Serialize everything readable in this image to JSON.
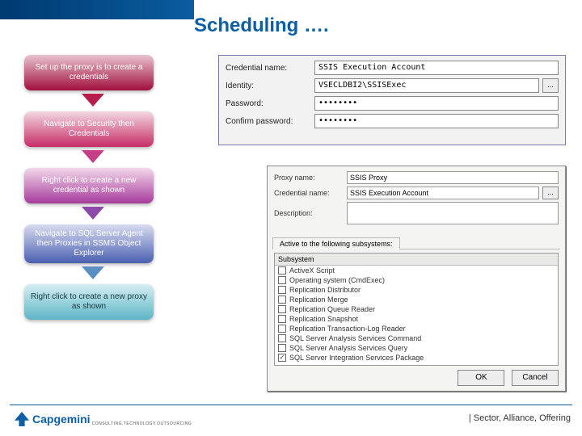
{
  "title": "Scheduling ….",
  "steps": [
    "Set up the proxy is to create a credentials",
    "Navigate to Security then Credentials",
    "Right click to create a new credential as shown",
    "Navigate to SQL Server Agent then Proxies in SSMS Object Explorer",
    "Right click to create a new proxy as shown"
  ],
  "credential": {
    "labels": {
      "name": "Credential name:",
      "identity": "Identity:",
      "password": "Password:",
      "confirm": "Confirm password:"
    },
    "values": {
      "name": "SSIS Execution Account",
      "identity": "VSECLDBI2\\SSISExec",
      "password": "••••••••",
      "confirm": "••••••••",
      "browse": "..."
    }
  },
  "proxy": {
    "labels": {
      "proxy_name": "Proxy name:",
      "cred_name": "Credential name:",
      "description": "Description:",
      "tab": "Active to the following subsystems:"
    },
    "values": {
      "proxy_name": "SSIS Proxy",
      "cred_name": "SSIS Execution Account",
      "browse": "..."
    },
    "list_header": "Subsystem",
    "subsystems": [
      {
        "label": "ActiveX Script",
        "checked": false
      },
      {
        "label": "Operating system (CmdExec)",
        "checked": false
      },
      {
        "label": "Replication Distributor",
        "checked": false
      },
      {
        "label": "Replication Merge",
        "checked": false
      },
      {
        "label": "Replication Queue Reader",
        "checked": false
      },
      {
        "label": "Replication Snapshot",
        "checked": false
      },
      {
        "label": "Replication Transaction-Log Reader",
        "checked": false
      },
      {
        "label": "SQL Server Analysis Services Command",
        "checked": false
      },
      {
        "label": "SQL Server Analysis Services Query",
        "checked": false
      },
      {
        "label": "SQL Server Integration Services Package",
        "checked": true
      }
    ],
    "buttons": {
      "ok": "OK",
      "cancel": "Cancel"
    }
  },
  "footer": "| Sector, Alliance, Offering",
  "logo": {
    "name": "Capgemini",
    "tag": "CONSULTING.TECHNOLOGY.OUTSOURCING"
  }
}
